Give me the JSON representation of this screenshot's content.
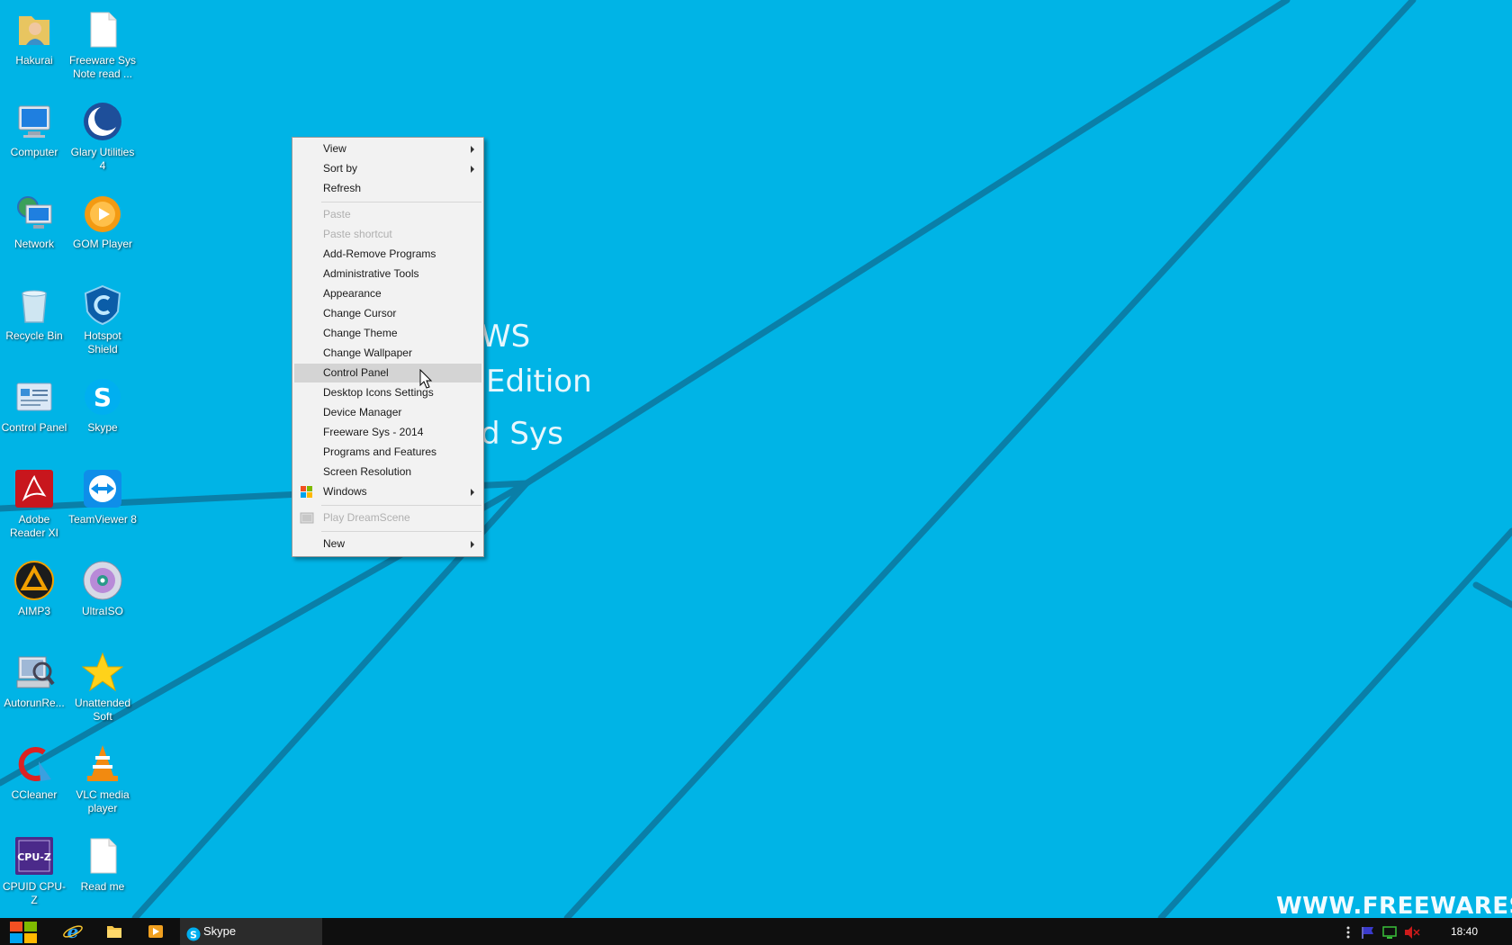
{
  "desktop": {
    "wallpaper_text": [
      "WS",
      "Edition",
      "d Sys"
    ],
    "watermark": "WWW.FREEWARESY",
    "icons": [
      {
        "label": "Hakurai",
        "icon": "user-folder-icon"
      },
      {
        "label": "Freeware Sys Note read ...",
        "icon": "text-document-icon"
      },
      {
        "label": "Computer",
        "icon": "computer-icon"
      },
      {
        "label": "Glary Utilities 4",
        "icon": "glary-utilities-icon"
      },
      {
        "label": "Network",
        "icon": "network-icon"
      },
      {
        "label": "GOM Player",
        "icon": "gom-player-icon"
      },
      {
        "label": "Recycle Bin",
        "icon": "recycle-bin-icon"
      },
      {
        "label": "Hotspot Shield",
        "icon": "hotspot-shield-icon"
      },
      {
        "label": "Control Panel",
        "icon": "control-panel-icon"
      },
      {
        "label": "Skype",
        "icon": "skype-icon"
      },
      {
        "label": "Adobe Reader XI",
        "icon": "adobe-reader-icon"
      },
      {
        "label": "TeamViewer 8",
        "icon": "teamviewer-icon"
      },
      {
        "label": "AIMP3",
        "icon": "aimp-icon"
      },
      {
        "label": "UltraISO",
        "icon": "ultraiso-disc-icon"
      },
      {
        "label": "AutorunRe...",
        "icon": "autorun-icon"
      },
      {
        "label": "Unattended Soft",
        "icon": "star-icon"
      },
      {
        "label": "CCleaner",
        "icon": "ccleaner-icon"
      },
      {
        "label": "VLC media player",
        "icon": "vlc-cone-icon"
      },
      {
        "label": "CPUID CPU-Z",
        "icon": "cpuz-icon"
      },
      {
        "label": "Read me",
        "icon": "text-document-icon"
      }
    ]
  },
  "context_menu": {
    "items": [
      {
        "label": "View",
        "submenu": true,
        "disabled": false
      },
      {
        "label": "Sort by",
        "submenu": true,
        "disabled": false
      },
      {
        "label": "Refresh",
        "submenu": false,
        "disabled": false
      },
      {
        "label": "Paste",
        "submenu": false,
        "disabled": true
      },
      {
        "label": "Paste shortcut",
        "submenu": false,
        "disabled": true
      },
      {
        "label": "Add-Remove Programs",
        "submenu": false,
        "disabled": false
      },
      {
        "label": "Administrative Tools",
        "submenu": false,
        "disabled": false
      },
      {
        "label": "Appearance",
        "submenu": false,
        "disabled": false
      },
      {
        "label": "Change Cursor",
        "submenu": false,
        "disabled": false
      },
      {
        "label": "Change Theme",
        "submenu": false,
        "disabled": false
      },
      {
        "label": "Change Wallpaper",
        "submenu": false,
        "disabled": false
      },
      {
        "label": "Control Panel",
        "submenu": false,
        "disabled": false,
        "highlighted": true
      },
      {
        "label": "Desktop Icons Settings",
        "submenu": false,
        "disabled": false
      },
      {
        "label": "Device Manager",
        "submenu": false,
        "disabled": false
      },
      {
        "label": "Freeware Sys - 2014",
        "submenu": false,
        "disabled": false
      },
      {
        "label": "Programs and Features",
        "submenu": false,
        "disabled": false
      },
      {
        "label": "Screen Resolution",
        "submenu": false,
        "disabled": false
      },
      {
        "label": "Windows",
        "submenu": true,
        "disabled": false,
        "icon": "windows-flag-icon"
      },
      {
        "label": "Play DreamScene",
        "submenu": false,
        "disabled": true,
        "icon": "dreamscene-icon"
      },
      {
        "label": "New",
        "submenu": true,
        "disabled": false
      }
    ]
  },
  "taskbar": {
    "start_icon": "windows-start-icon",
    "pinned": [
      "internet-explorer-icon",
      "file-explorer-icon",
      "media-player-icon"
    ],
    "active_window": "Skype",
    "tray_icons": [
      "overflow-dots-icon",
      "action-center-flag-icon",
      "network-monitor-icon",
      "volume-muted-icon"
    ],
    "clock": "18:40"
  },
  "colors": {
    "desktop_bg": "#00b4e6",
    "wallpaper_lines": "#0a7fa8",
    "taskbar_bg": "#0f0f0f",
    "menu_bg": "#f2f2f2",
    "menu_highlight": "#d4d4d4"
  }
}
